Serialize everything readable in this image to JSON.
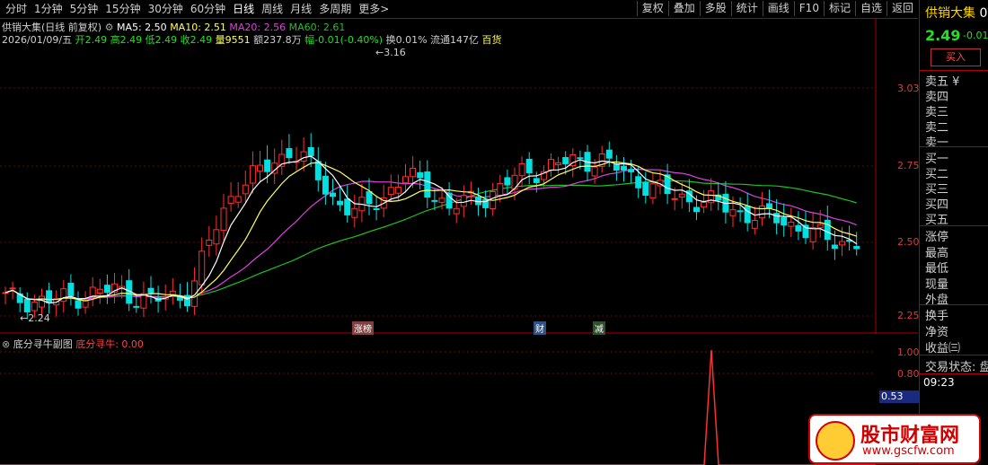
{
  "toolbar": {
    "periods": [
      "分时",
      "1分钟",
      "5分钟",
      "15分钟",
      "30分钟",
      "60分钟",
      "日线",
      "周线",
      "月线",
      "多周期",
      "更多>"
    ],
    "active_period": "日线",
    "actions": [
      "复权",
      "叠加",
      "多股",
      "统计",
      "画线",
      "F10",
      "标记",
      "自选",
      "返回"
    ]
  },
  "info": {
    "title": "供销大集(日线 前复权)",
    "ma5": "MA5: 2.50",
    "ma10": "MA10: 2.51",
    "ma20": "MA20: 2.56",
    "ma60": "MA60: 2.61",
    "date": "2026/01/09/五",
    "open": "开2.49",
    "high": "高2.49",
    "low": "低2.49",
    "close": "收2.49",
    "vol": "量9551",
    "amount": "额237.8万",
    "change": "幅-0.01(-0.40%)",
    "turnover": "换0.01%",
    "float": "流通147亿",
    "sector": "百货"
  },
  "price_axis": [
    "3.03",
    "2.75",
    "2.50",
    "2.25"
  ],
  "annotations": {
    "high_mark": "3.16",
    "low_mark": "2.24",
    "tag1": "涨榜",
    "tag2": "财",
    "tag3": "减"
  },
  "sub_chart": {
    "title": "底分寻牛副图",
    "indicator": "底分寻牛: 0.00",
    "axis": [
      "1.00",
      "0.80"
    ],
    "value_label": "0.53"
  },
  "right_panel": {
    "name": "供销大集",
    "code_prefix": "0",
    "price": "2.49",
    "change": "-0.01",
    "buy_button": "买入",
    "sell_rows": [
      "卖五",
      "卖四",
      "卖三",
      "卖二",
      "卖一"
    ],
    "sell_yen": "¥",
    "buy_rows": [
      "买一",
      "买二",
      "买三",
      "买四",
      "买五"
    ],
    "stats": [
      "涨停",
      "最高",
      "最低",
      "现量",
      "外盘"
    ],
    "stats2": [
      "换手",
      "净资",
      "收益㈢"
    ],
    "trade_status": "交易状态: 盘",
    "time": "09:23"
  },
  "logo": {
    "main": "股市财富网",
    "url": "www.gscfw.com"
  },
  "colors": {
    "up": "#ff3030",
    "down": "#00e0e0",
    "ma5": "#ffffff",
    "ma10": "#ffff60",
    "ma20": "#e040e0",
    "ma60": "#20c020"
  }
}
